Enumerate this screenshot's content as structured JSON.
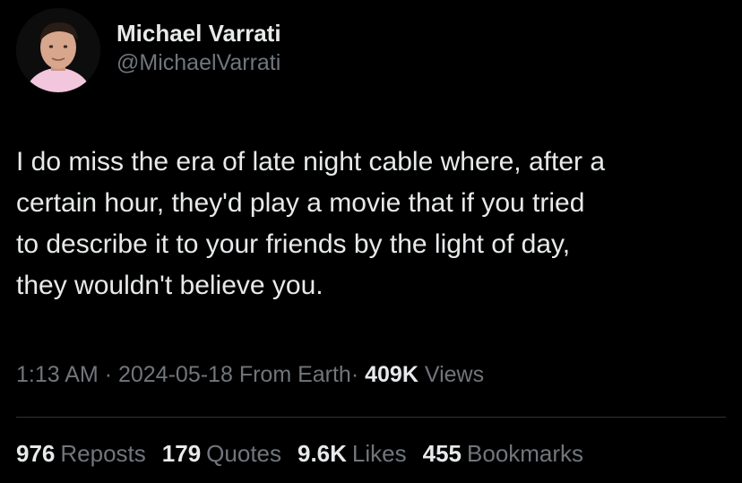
{
  "author": {
    "display_name": "Michael Varrati",
    "handle": "@MichaelVarrati",
    "avatar_icon": "profile-photo"
  },
  "tweet": {
    "text": "I do miss the era of late night cable where, after a\ncertain hour, they'd play a movie that if you tried\nto describe it to your friends by the light of day,\nthey wouldn't believe you."
  },
  "meta": {
    "time": "1:13 AM",
    "sep1": "·",
    "date": "2024-05-18",
    "source": "From Earth",
    "sep2": "·",
    "views_count": "409K",
    "views_label": "Views"
  },
  "stats": {
    "reposts": {
      "count": "976",
      "label": "Reposts"
    },
    "quotes": {
      "count": "179",
      "label": "Quotes"
    },
    "likes": {
      "count": "9.6K",
      "label": "Likes"
    },
    "bookmarks": {
      "count": "455",
      "label": "Bookmarks"
    }
  },
  "colors": {
    "background": "#000000",
    "primary_text": "#e7e9ea",
    "secondary_text": "#71767b",
    "divider": "#2f3336"
  }
}
